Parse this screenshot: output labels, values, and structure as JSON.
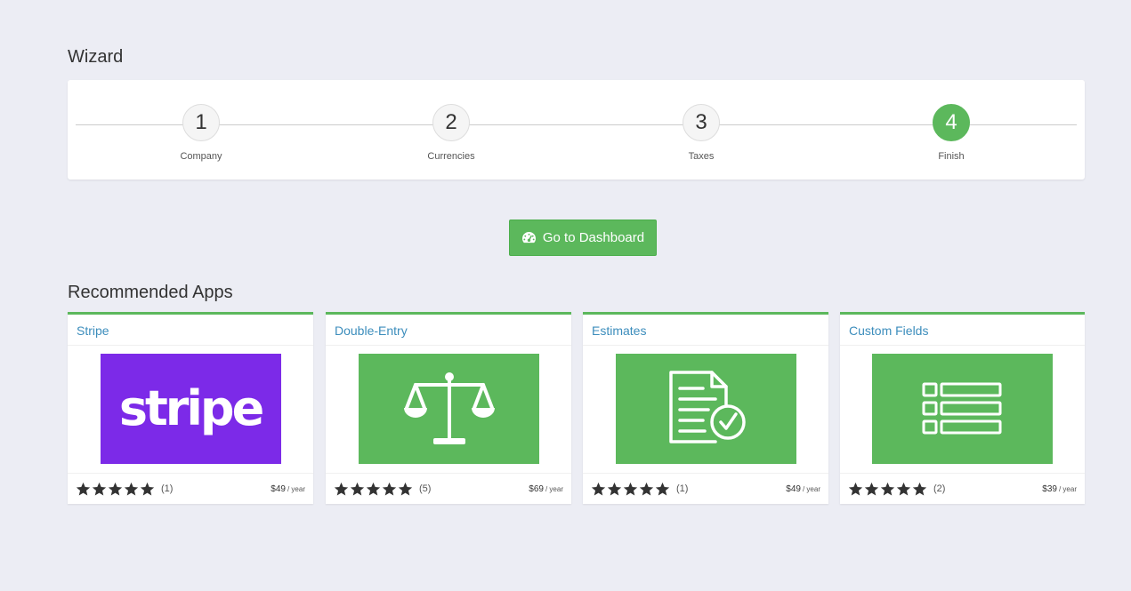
{
  "page": {
    "title": "Wizard"
  },
  "wizard": {
    "steps": [
      {
        "number": "1",
        "label": "Company",
        "active": false
      },
      {
        "number": "2",
        "label": "Currencies",
        "active": false
      },
      {
        "number": "3",
        "label": "Taxes",
        "active": false
      },
      {
        "number": "4",
        "label": "Finish",
        "active": true
      }
    ],
    "active_color": "#5cb85c"
  },
  "dashboard_button": {
    "label": "Go to Dashboard",
    "icon": "dashboard-gauge-icon"
  },
  "recommended": {
    "title": "Recommended Apps",
    "apps": [
      {
        "name": "Stripe",
        "logo_text": "stripe",
        "image": "stripe-logo",
        "image_bg": "#7c2ae8",
        "rating": 5,
        "reviews": "(1)",
        "price": "$49",
        "period": "/ year"
      },
      {
        "name": "Double-Entry",
        "image": "balance-scale-icon",
        "image_bg": "#5cb85c",
        "rating": 5,
        "reviews": "(5)",
        "price": "$69",
        "period": "/ year"
      },
      {
        "name": "Estimates",
        "image": "document-check-icon",
        "image_bg": "#5cb85c",
        "rating": 5,
        "reviews": "(1)",
        "price": "$49",
        "period": "/ year"
      },
      {
        "name": "Custom Fields",
        "image": "list-fields-icon",
        "image_bg": "#5cb85c",
        "rating": 5,
        "reviews": "(2)",
        "price": "$39",
        "period": "/ year"
      }
    ]
  }
}
